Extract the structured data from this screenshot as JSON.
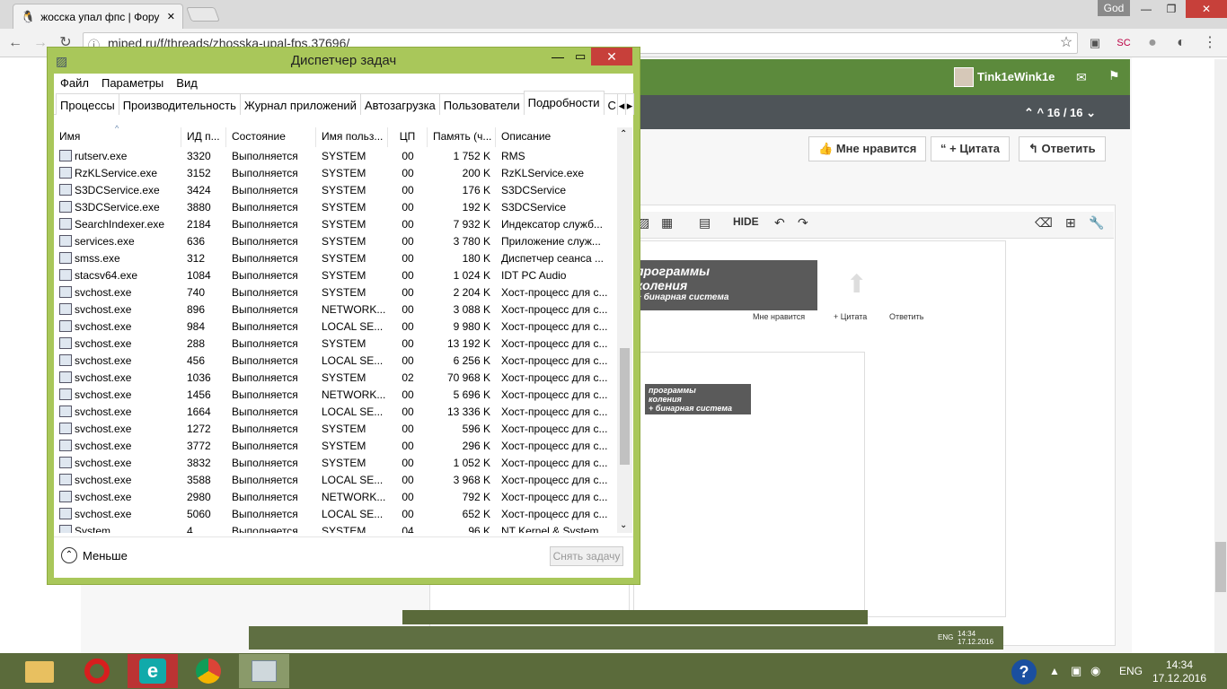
{
  "browser": {
    "tab_title": "жосска упал фпс | Фору",
    "url": "miped.ru/f/threads/zhosska-upal-fps.37696/",
    "os_user": "God"
  },
  "forum": {
    "user": "Tink1eWink1e",
    "pager": "16 / 16",
    "like": "Мне нравится",
    "quote": "+ Цитата",
    "reply": "Ответить",
    "hide": "HIDE",
    "banner_line1": "программы",
    "banner_line2": "коления",
    "banner_line3": "+ бинарная система",
    "mini_like": "Мне нравится",
    "mini_quote": "+ Цитата",
    "mini_reply": "Ответить",
    "inner_time": "14:34",
    "inner_date": "17.12.2016",
    "inner_lang": "ENG"
  },
  "taskmanager": {
    "title": "Диспетчер задач",
    "menu": [
      "Файл",
      "Параметры",
      "Вид"
    ],
    "tabs": [
      "Процессы",
      "Производительность",
      "Журнал приложений",
      "Автозагрузка",
      "Пользователи",
      "Подробности",
      "С..."
    ],
    "columns": [
      "Имя",
      "ИД п...",
      "Состояние",
      "Имя польз...",
      "ЦП",
      "Память (ч...",
      "Описание"
    ],
    "rows": [
      [
        "rutserv.exe",
        "3320",
        "Выполняется",
        "SYSTEM",
        "00",
        "1 752 K",
        "RMS"
      ],
      [
        "RzKLService.exe",
        "3152",
        "Выполняется",
        "SYSTEM",
        "00",
        "200 K",
        "RzKLService.exe"
      ],
      [
        "S3DCService.exe",
        "3424",
        "Выполняется",
        "SYSTEM",
        "00",
        "176 K",
        "S3DCService"
      ],
      [
        "S3DCService.exe",
        "3880",
        "Выполняется",
        "SYSTEM",
        "00",
        "192 K",
        "S3DCService"
      ],
      [
        "SearchIndexer.exe",
        "2184",
        "Выполняется",
        "SYSTEM",
        "00",
        "7 932 K",
        "Индексатор служб..."
      ],
      [
        "services.exe",
        "636",
        "Выполняется",
        "SYSTEM",
        "00",
        "3 780 K",
        "Приложение служ..."
      ],
      [
        "smss.exe",
        "312",
        "Выполняется",
        "SYSTEM",
        "00",
        "180 K",
        "Диспетчер сеанса ..."
      ],
      [
        "stacsv64.exe",
        "1084",
        "Выполняется",
        "SYSTEM",
        "00",
        "1 024 K",
        "IDT PC Audio"
      ],
      [
        "svchost.exe",
        "740",
        "Выполняется",
        "SYSTEM",
        "00",
        "2 204 K",
        "Хост-процесс для с..."
      ],
      [
        "svchost.exe",
        "896",
        "Выполняется",
        "NETWORK...",
        "00",
        "3 088 K",
        "Хост-процесс для с..."
      ],
      [
        "svchost.exe",
        "984",
        "Выполняется",
        "LOCAL SE...",
        "00",
        "9 980 K",
        "Хост-процесс для с..."
      ],
      [
        "svchost.exe",
        "288",
        "Выполняется",
        "SYSTEM",
        "00",
        "13 192 K",
        "Хост-процесс для с..."
      ],
      [
        "svchost.exe",
        "456",
        "Выполняется",
        "LOCAL SE...",
        "00",
        "6 256 K",
        "Хост-процесс для с..."
      ],
      [
        "svchost.exe",
        "1036",
        "Выполняется",
        "SYSTEM",
        "02",
        "70 968 K",
        "Хост-процесс для с..."
      ],
      [
        "svchost.exe",
        "1456",
        "Выполняется",
        "NETWORK...",
        "00",
        "5 696 K",
        "Хост-процесс для с..."
      ],
      [
        "svchost.exe",
        "1664",
        "Выполняется",
        "LOCAL SE...",
        "00",
        "13 336 K",
        "Хост-процесс для с..."
      ],
      [
        "svchost.exe",
        "1272",
        "Выполняется",
        "SYSTEM",
        "00",
        "596 K",
        "Хост-процесс для с..."
      ],
      [
        "svchost.exe",
        "3772",
        "Выполняется",
        "SYSTEM",
        "00",
        "296 K",
        "Хост-процесс для с..."
      ],
      [
        "svchost.exe",
        "3832",
        "Выполняется",
        "SYSTEM",
        "00",
        "1 052 K",
        "Хост-процесс для с..."
      ],
      [
        "svchost.exe",
        "3588",
        "Выполняется",
        "LOCAL SE...",
        "00",
        "3 968 K",
        "Хост-процесс для с..."
      ],
      [
        "svchost.exe",
        "2980",
        "Выполняется",
        "NETWORK...",
        "00",
        "792 K",
        "Хост-процесс для с..."
      ],
      [
        "svchost.exe",
        "5060",
        "Выполняется",
        "LOCAL SE...",
        "00",
        "652 K",
        "Хост-процесс для с..."
      ],
      [
        "System",
        "4",
        "Выполняется",
        "SYSTEM",
        "04",
        "96 K",
        "NT Kernel & System"
      ]
    ],
    "less_label": "Меньше",
    "end_task_label": "Снять задачу"
  },
  "taskbar": {
    "lang": "ENG",
    "time": "14:34",
    "date": "17.12.2016"
  },
  "colors": {
    "taskbar": "#5b6b3b",
    "tm_border": "#a9c75a",
    "forum_header": "#5c8a3c",
    "close_red": "#c7403a"
  }
}
